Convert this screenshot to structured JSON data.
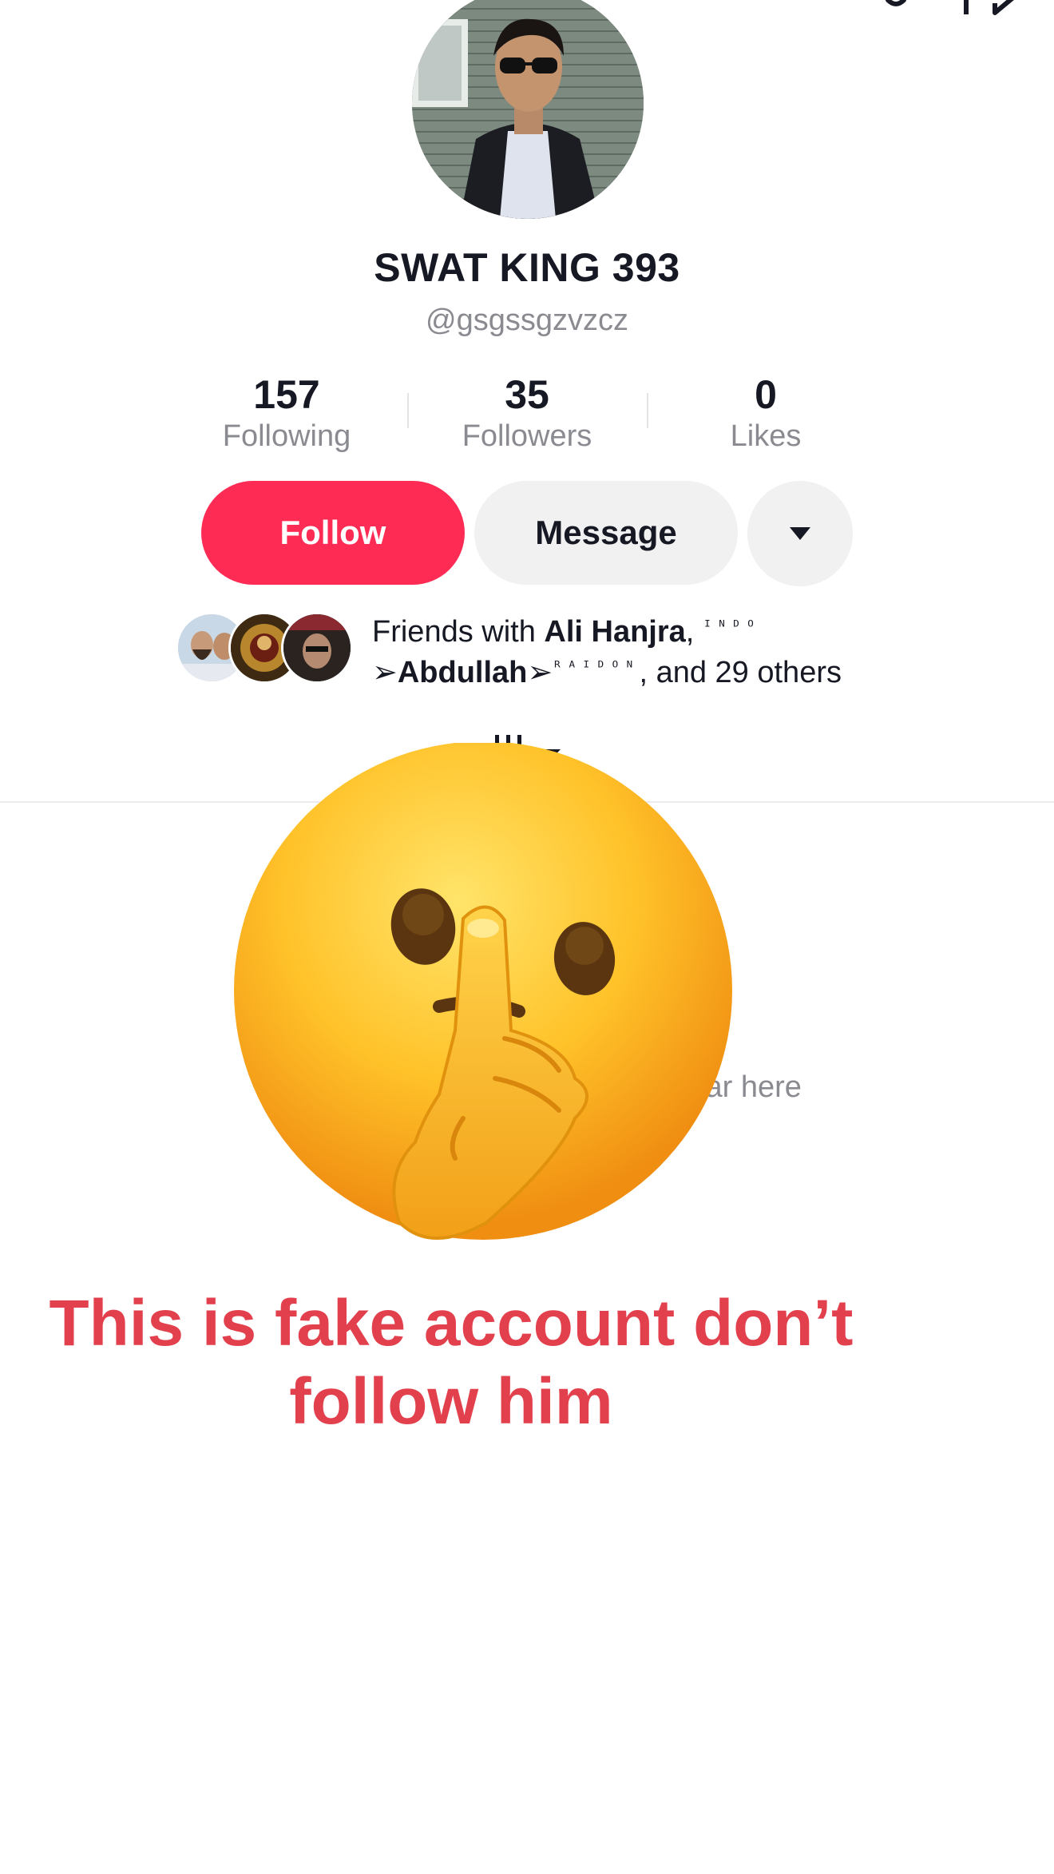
{
  "profile": {
    "display_name": "SWAT KING 393",
    "username": "@gsgssgzvzcz"
  },
  "stats": [
    {
      "value": "157",
      "label": "Following"
    },
    {
      "value": "35",
      "label": "Followers"
    },
    {
      "value": "0",
      "label": "Likes"
    }
  ],
  "actions": {
    "follow_label": "Follow",
    "message_label": "Message",
    "more_icon": "caret-down-icon"
  },
  "friends": {
    "prefix": "Friends with ",
    "friend1": "Ali Hanjra",
    "sep": ", ",
    "friend2_deco": "ᴵᴺᴰᴼ",
    "friend2_name": "➢Abdullah➢",
    "friend2_suffix": "ᴿᴬᴵᴰᴼᴺ",
    "tail": ", and 29 others"
  },
  "empty_state": "Videos liked by this user will appear here",
  "overlay": {
    "emoji": "shushing-face",
    "warning_line1": "This is fake account don’t",
    "warning_line2": "follow him",
    "color": "#e2404c"
  },
  "colors": {
    "follow": "#fe2c55",
    "secondary_btn": "#f1f1f2",
    "muted_text": "#8a8b91"
  }
}
